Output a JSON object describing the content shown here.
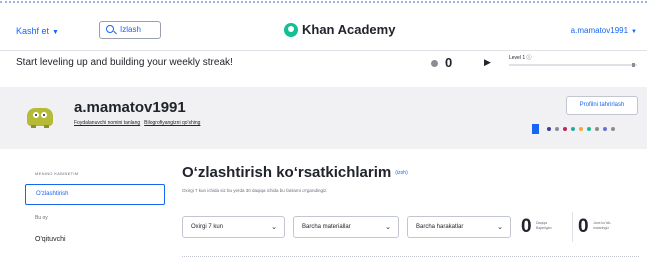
{
  "header": {
    "explore_label": "Kashf et",
    "search_placeholder": "Izlash",
    "brand_name": "Khan Academy",
    "user_menu_label": "a.mamatov1991"
  },
  "streak": {
    "message": "Start leveling up and building your weekly streak!",
    "energy_points": "0",
    "level_label": "Level 1 ⓘ",
    "level_progress": 0
  },
  "profile": {
    "username": "a.mamatov1991",
    "links": [
      "Foydalanuvchi nomini tanlang",
      "Bilogrofiyangizni qo'shing"
    ],
    "edit_button": "Profilni tahrirlash",
    "colors": {
      "badge_square": "#1865f2",
      "avatar_body": "#b6bb37",
      "accent": "#1865f2",
      "badge_dots": [
        "#3b3f9a",
        "#8a8d94",
        "#c0245b",
        "#2aa8a0",
        "#f2a93b",
        "#14bf96",
        "#8a8d94",
        "#6a6fd6",
        "#8a8d94"
      ]
    }
  },
  "sidebar": {
    "section_heading": "MENING KABINETIM",
    "active_item": "O'zlashtirish",
    "section2_heading": "Bu oy",
    "item": "O'qituvchi"
  },
  "main": {
    "title": "O‘zlashtirish ko‘rsatkichlarim",
    "title_help": "(izoh)",
    "subtitle": "Oxirgi 7 kun ichida siz bu yerda 30 daqiqa ichida bu fanlarni o'rgandingiz.",
    "filters": [
      "Oxirgi 7 kun",
      "Barcha materiallar",
      "Barcha harakatlar"
    ],
    "stats": [
      {
        "value": "0",
        "label_line1": "Daqiqa",
        "label_line2": "Bajarilgan"
      },
      {
        "value": "0",
        "label_line1": "Jami ko'nik-",
        "label_line2": "malaringiz"
      }
    ]
  }
}
